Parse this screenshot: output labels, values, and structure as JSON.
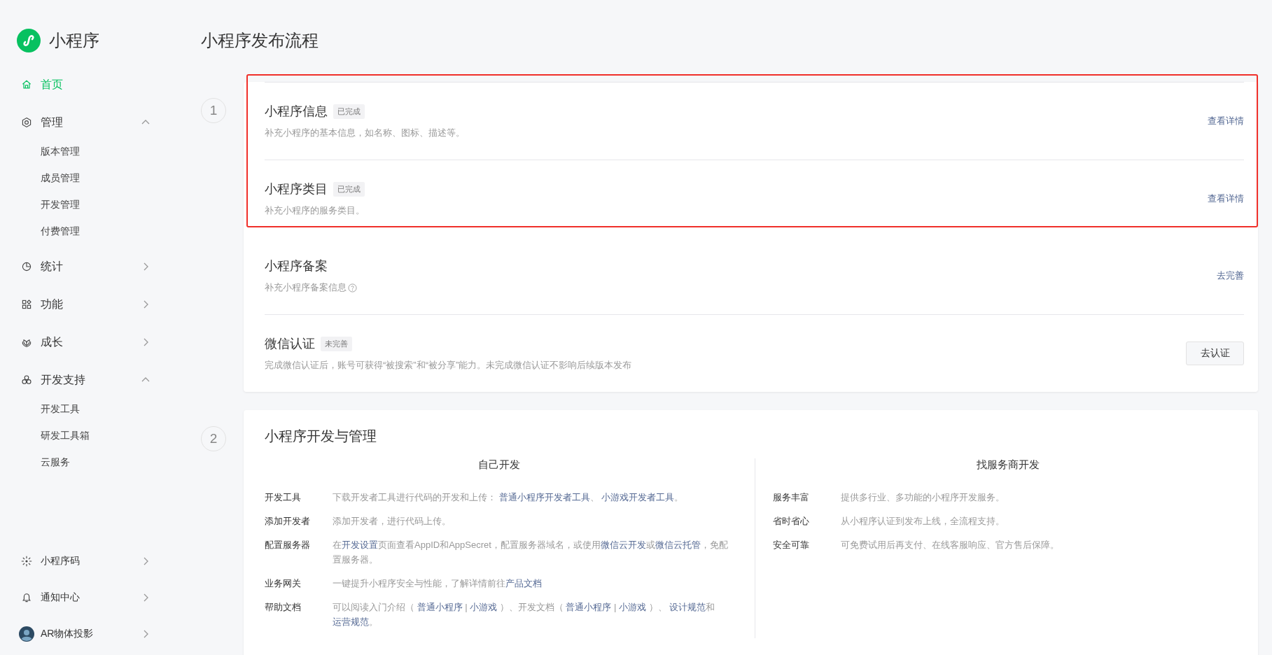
{
  "sidebar": {
    "brand": "小程序",
    "nav": [
      {
        "label": "首页",
        "selected": true,
        "expanded": false
      },
      {
        "label": "管理",
        "selected": false,
        "expanded": true,
        "children": [
          {
            "label": "版本管理"
          },
          {
            "label": "成员管理"
          },
          {
            "label": "开发管理"
          },
          {
            "label": "付费管理"
          }
        ]
      },
      {
        "label": "统计",
        "selected": false,
        "expanded": false
      },
      {
        "label": "功能",
        "selected": false,
        "expanded": false
      },
      {
        "label": "成长",
        "selected": false,
        "expanded": false
      },
      {
        "label": "开发支持",
        "selected": false,
        "expanded": true,
        "children": [
          {
            "label": "开发工具"
          },
          {
            "label": "研发工具箱"
          },
          {
            "label": "云服务"
          }
        ]
      }
    ],
    "footer": [
      {
        "label": "小程序码",
        "kind": "code"
      },
      {
        "label": "通知中心",
        "kind": "bell"
      },
      {
        "label": "AR物体投影",
        "kind": "account"
      }
    ]
  },
  "page_title": "小程序发布流程",
  "steps": [
    {
      "number": "1",
      "tasks": [
        {
          "title": "小程序信息",
          "status": "已完成",
          "desc": "补充小程序的基本信息，如名称、图标、描述等。",
          "help": false,
          "action": {
            "text": "查看详情",
            "kind": "link"
          },
          "highlighted": true
        },
        {
          "title": "小程序类目",
          "status": "已完成",
          "desc": "补充小程序的服务类目。",
          "help": false,
          "action": {
            "text": "查看详情",
            "kind": "link"
          },
          "highlighted": true
        },
        {
          "title": "小程序备案",
          "desc": "补充小程序备案信息",
          "help": true,
          "action": {
            "text": "去完善",
            "kind": "link"
          },
          "highlighted": false
        },
        {
          "title": "微信认证",
          "status": "未完善",
          "desc": "完成微信认证后，账号可获得“被搜索”和“被分享”能力。未完成微信认证不影响后续版本发布",
          "help": false,
          "action": {
            "text": "去认证",
            "kind": "button"
          },
          "highlighted": false
        }
      ]
    },
    {
      "number": "2",
      "title": "小程序开发与管理",
      "columns": [
        {
          "heading": "自己开发",
          "rows": [
            {
              "label": "开发工具",
              "desc": [
                {
                  "text": "下载开发者工具进行代码的开发和上传： ",
                  "link": false
                },
                {
                  "text": "普通小程序开发者工具",
                  "link": true
                },
                {
                  "text": "、 ",
                  "link": false
                },
                {
                  "text": "小游戏开发者工具",
                  "link": true
                },
                {
                  "text": "。",
                  "link": false
                }
              ]
            },
            {
              "label": "添加开发者",
              "desc": [
                {
                  "text": "添加开发者，进行代码上传。",
                  "link": false
                }
              ]
            },
            {
              "label": "配置服务器",
              "desc": [
                {
                  "text": "在",
                  "link": false
                },
                {
                  "text": "开发设置",
                  "link": true
                },
                {
                  "text": "页面查看AppID和AppSecret，配置服务器域名，或使用",
                  "link": false
                },
                {
                  "text": "微信云开发",
                  "link": true
                },
                {
                  "text": "或",
                  "link": false
                },
                {
                  "text": "微信云托管",
                  "link": true
                },
                {
                  "text": "，免配置服务器。",
                  "link": false
                }
              ]
            },
            {
              "label": "业务网关",
              "desc": [
                {
                  "text": "一键提升小程序安全与性能，了解详情前往",
                  "link": false
                },
                {
                  "text": "产品文档",
                  "link": true
                }
              ]
            },
            {
              "label": "帮助文档",
              "desc": [
                {
                  "text": "可以阅读入门介绍（ ",
                  "link": false
                },
                {
                  "text": "普通小程序",
                  "link": true
                },
                {
                  "text": " | ",
                  "link": false
                },
                {
                  "text": "小游戏",
                  "link": true
                },
                {
                  "text": " ）、开发文档（ ",
                  "link": false
                },
                {
                  "text": "普通小程序",
                  "link": true
                },
                {
                  "text": " | ",
                  "link": false
                },
                {
                  "text": "小游戏",
                  "link": true
                },
                {
                  "text": " ）、 ",
                  "link": false
                },
                {
                  "text": "设计规范",
                  "link": true
                },
                {
                  "text": "和",
                  "link": false
                },
                {
                  "text": "运营规范",
                  "link": true
                },
                {
                  "text": "。",
                  "link": false
                }
              ]
            }
          ]
        },
        {
          "heading": "找服务商开发",
          "rows": [
            {
              "label": "服务丰富",
              "desc": [
                {
                  "text": "提供多行业、多功能的小程序开发服务。",
                  "link": false
                }
              ]
            },
            {
              "label": "省时省心",
              "desc": [
                {
                  "text": "从小程序认证到发布上线，全流程支持。",
                  "link": false
                }
              ]
            },
            {
              "label": "安全可靠",
              "desc": [
                {
                  "text": "可免费试用后再支付、在线客服响应、官方售后保障。",
                  "link": false
                }
              ]
            }
          ]
        }
      ]
    }
  ]
}
